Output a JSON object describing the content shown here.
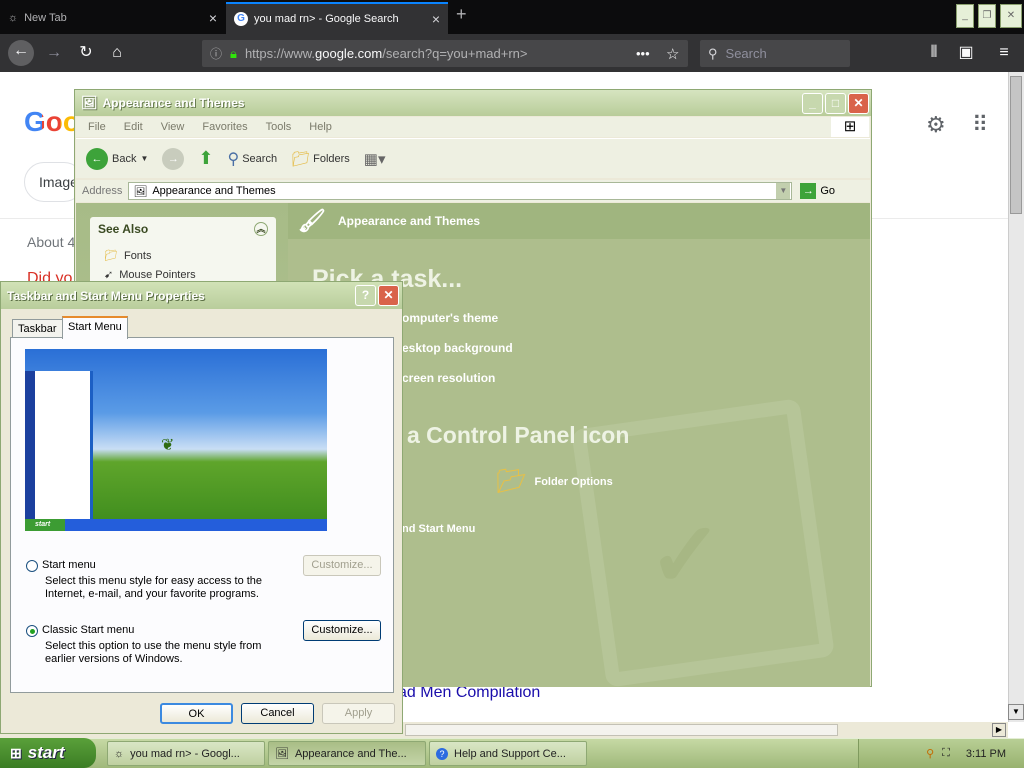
{
  "browser": {
    "tabs": [
      {
        "label": "New Tab",
        "close": "×"
      },
      {
        "label": "you mad rn> - Google Search",
        "close": "×"
      }
    ],
    "new_tab": "+",
    "url": {
      "prefix": "https://www.",
      "host": "google.com",
      "path": "/search?q=you+mad+rn>"
    },
    "search_placeholder": "Search",
    "page_actions": "•••",
    "win_buttons": [
      "_",
      "❐",
      "✕"
    ]
  },
  "google_page": {
    "logo": "Goog",
    "tab_images": "Image",
    "about": "About 4",
    "did_you": "Did yo",
    "result_link": "ad Men Compilation"
  },
  "explorer": {
    "title": "Appearance and Themes",
    "menu": [
      "File",
      "Edit",
      "View",
      "Favorites",
      "Tools",
      "Help"
    ],
    "toolbar": {
      "back": "Back",
      "search": "Search",
      "folders": "Folders"
    },
    "address_label": "Address",
    "address_value": "Appearance and Themes",
    "go": "Go",
    "see_also": {
      "header": "See Also",
      "items": [
        "Fonts",
        "Mouse Pointers"
      ]
    },
    "right_header": "Appearance and Themes",
    "pick_task": "Pick a task...",
    "tasks": [
      "omputer's theme",
      "esktop background",
      "creen resolution"
    ],
    "pick_icon": "a Control Panel icon",
    "icons": [
      "Folder Options",
      "nd Start Menu"
    ]
  },
  "dialog": {
    "title": "Taskbar and Start Menu Properties",
    "help_btn": "?",
    "close_btn": "✕",
    "tabs": [
      "Taskbar",
      "Start Menu"
    ],
    "preview_start": "start",
    "options": [
      {
        "label": "Start menu",
        "desc1": "Select this menu style for easy access to the",
        "desc2": "Internet, e-mail, and your favorite programs.",
        "button": "Customize...",
        "selected": false
      },
      {
        "label": "Classic Start menu",
        "desc1": "Select this option to use the menu style from",
        "desc2": "earlier versions of Windows.",
        "button": "Customize...",
        "selected": true
      }
    ],
    "ok": "OK",
    "cancel": "Cancel",
    "apply": "Apply"
  },
  "taskbar": {
    "start": "start",
    "items": [
      "you mad rn> - Googl...",
      "Appearance and The...",
      "Help and Support Ce..."
    ],
    "clock": "3:11 PM"
  }
}
